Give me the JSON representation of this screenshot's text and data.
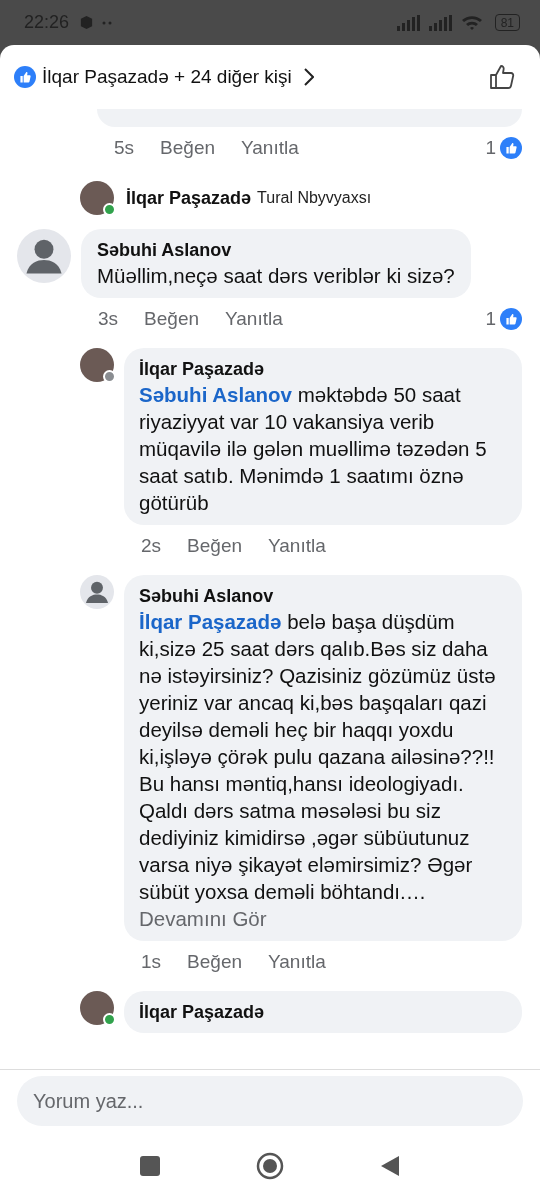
{
  "status_bar": {
    "time": "22:26",
    "battery": "81"
  },
  "header": {
    "reactors": "İlqar Paşazadə + 24 diğer kişi"
  },
  "comments": [
    {
      "kind": "tail",
      "nested": true,
      "time": "5s",
      "like": "Beğen",
      "reply": "Yanıtla",
      "reactions": "1"
    },
    {
      "kind": "preview",
      "nested": true,
      "author": "İlqar Paşazadə",
      "text": "Tural Nbyvyaxsı",
      "has_photo": true,
      "online": true
    },
    {
      "kind": "comment",
      "nested": false,
      "author": "Səbuhi Aslanov",
      "has_photo": false,
      "text": "Müəllim,neçə saat dərs veriblər ki sizə?",
      "time": "3s",
      "like": "Beğen",
      "reply": "Yanıtla",
      "reactions": "1"
    },
    {
      "kind": "comment",
      "nested": true,
      "author": "İlqar Paşazadə",
      "has_photo": true,
      "online": false,
      "mention": "Səbuhi Aslanov",
      "text": "məktəbdə 50 saat riyaziyyat var 10 vakansiya verib müqavilə ilə gələn muəllimə təzədən 5 saat satıb. Mənimdə 1 saatımı öznə götürüb",
      "time": "2s",
      "like": "Beğen",
      "reply": "Yanıtla"
    },
    {
      "kind": "comment",
      "nested": true,
      "author": "Səbuhi Aslanov",
      "has_photo": false,
      "mention": "İlqar Paşazadə",
      "text": "belə başa düşdüm ki,sizə 25 saat dərs qalıb.Bəs siz daha nə istəyirsiniz? Qazisiniz gözümüz üstə yeriniz var ancaq ki,bəs başqaları qazi deyilsə deməli heç bir haqqı yoxdu ki,işləyə çörək pulu qazana ailəsinə??!! Bu hansı məntiq,hansı ideologiyadı. Qaldı  dərs satma məsələsi bu siz dediyiniz kimidirsə ,əgər sübüutunuz varsa niyə şikayət eləmirsimiz? Əgər sübüt yoxsa deməli böhtandı.…",
      "more": "Devamını Gör",
      "time": "1s",
      "like": "Beğen",
      "reply": "Yanıtla"
    },
    {
      "kind": "comment",
      "nested": true,
      "author": "İlqar Paşazadə",
      "has_photo": true,
      "online": true
    }
  ],
  "composer": {
    "placeholder": "Yorum yaz..."
  }
}
